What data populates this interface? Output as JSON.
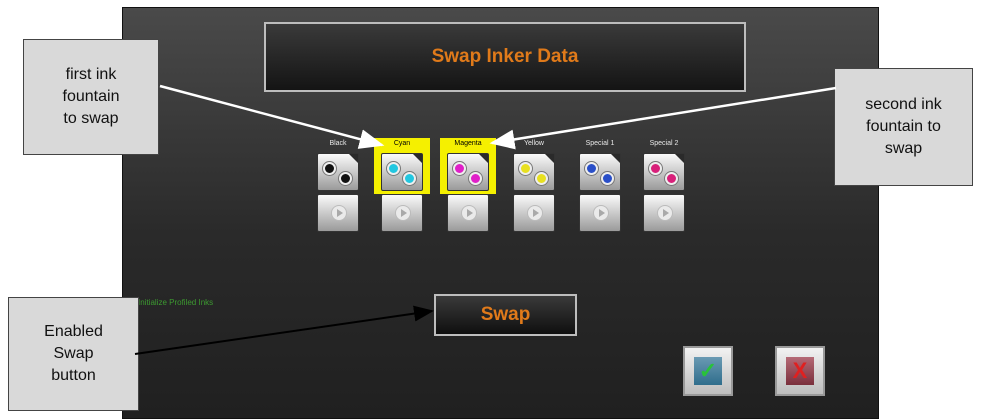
{
  "dialog": {
    "title": "Swap Inker Data",
    "status_text": "Initialize Profiled Inks",
    "swap_label": "Swap",
    "ok_mark": "✓",
    "cancel_mark": "X"
  },
  "fountains": [
    {
      "label": "Black",
      "color": "#111111",
      "selected": false
    },
    {
      "label": "Cyan",
      "color": "#22c7e0",
      "selected": true
    },
    {
      "label": "Magenta",
      "color": "#e020c8",
      "selected": true
    },
    {
      "label": "Yellow",
      "color": "#e8e020",
      "selected": false
    },
    {
      "label": "Special 1",
      "color": "#2a4fc8",
      "selected": false
    },
    {
      "label": "Special 2",
      "color": "#d8207a",
      "selected": false
    }
  ],
  "callouts": {
    "first": [
      "first ink",
      "fountain",
      "to swap"
    ],
    "second": [
      "second ink",
      "fountain to",
      "swap"
    ],
    "swap": [
      "Enabled",
      "Swap",
      "button"
    ]
  },
  "colors": {
    "accent_orange": "#e07a1a",
    "selection_yellow": "#f5f000",
    "ok_green": "#29c23a",
    "cancel_red": "#e02020"
  }
}
